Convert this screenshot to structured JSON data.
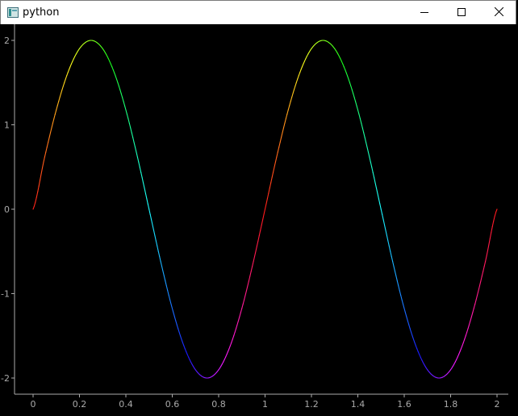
{
  "window": {
    "title": "python",
    "icon": "app-window-icon",
    "buttons": {
      "minimize": "minimize-icon",
      "maximize": "maximize-icon",
      "close": "close-icon"
    }
  },
  "chart_data": {
    "type": "line",
    "title": "",
    "xlabel": "",
    "ylabel": "",
    "xlim": [
      0,
      2
    ],
    "ylim": [
      -2,
      2
    ],
    "grid": false,
    "background": "#000000",
    "axis_color": "#aaaaaa",
    "x_ticks": [
      "0",
      "0.2",
      "0.4",
      "0.6",
      "0.8",
      "1",
      "1.2",
      "1.4",
      "1.6",
      "1.8",
      "2"
    ],
    "y_ticks": [
      "-2",
      "-1",
      "0",
      "1",
      "2"
    ],
    "series": [
      {
        "style": "rainbow-gradient",
        "x": [
          0,
          0.05,
          0.1,
          0.15,
          0.2,
          0.25,
          0.3,
          0.35,
          0.4,
          0.45,
          0.5,
          0.55,
          0.6,
          0.65,
          0.7,
          0.75,
          0.8,
          0.85,
          0.9,
          0.95,
          1,
          1.05,
          1.1,
          1.15,
          1.2,
          1.25,
          1.3,
          1.35,
          1.4,
          1.45,
          1.5,
          1.55,
          1.6,
          1.65,
          1.7,
          1.75,
          1.8,
          1.85,
          1.9,
          1.95,
          2
        ],
        "y": [
          0,
          0.618,
          1.176,
          1.618,
          1.902,
          2,
          1.902,
          1.618,
          1.176,
          0.618,
          0,
          -0.618,
          -1.176,
          -1.618,
          -1.902,
          -2,
          -1.902,
          -1.618,
          -1.176,
          -0.618,
          0,
          0.618,
          1.176,
          1.618,
          1.902,
          2,
          1.902,
          1.618,
          1.176,
          0.618,
          0,
          -0.618,
          -1.176,
          -1.618,
          -1.902,
          -2,
          -1.902,
          -1.618,
          -1.176,
          -0.618,
          0
        ]
      }
    ]
  }
}
